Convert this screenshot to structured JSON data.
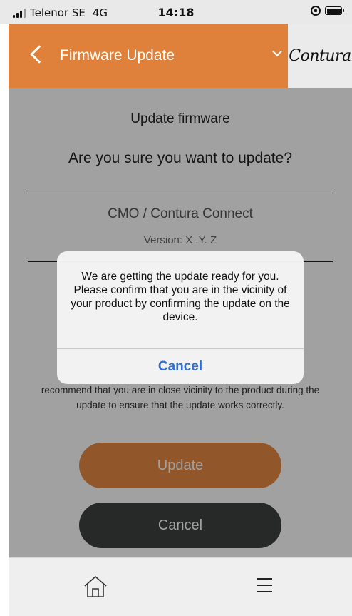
{
  "status_bar": {
    "carrier": "Telenor SE",
    "network": "4G",
    "time": "14:18",
    "icons": [
      "signal-icon",
      "orientation-lock-icon",
      "battery-icon"
    ]
  },
  "nav": {
    "title": "Firmware Update",
    "brand": "Contura",
    "colors": {
      "bar": "#e0813b",
      "brand_bg": "#ebebeb"
    },
    "icons": [
      "back-icon",
      "chevron-down-icon"
    ]
  },
  "content": {
    "title": "Update firmware",
    "question": "Are you sure you want to update?",
    "product": "CMO / Contura Connect",
    "version": "Version: X .Y. Z",
    "notice_partial": "recommend that you are in close vicinity to the product during the update to ensure that the update works correctly.",
    "update_label": "Update",
    "cancel_label": "Cancel",
    "colors": {
      "update_button": "#e68a44",
      "cancel_button": "#3f4040"
    }
  },
  "dialog": {
    "message": "We are getting the update ready for you. Please confirm that you are in the vicinity of your product by confirming the update on the device.",
    "cancel_label": "Cancel",
    "colors": {
      "action": "#2e6fd1"
    }
  },
  "tab_bar": {
    "icons": [
      "home-icon",
      "menu-icon"
    ]
  }
}
